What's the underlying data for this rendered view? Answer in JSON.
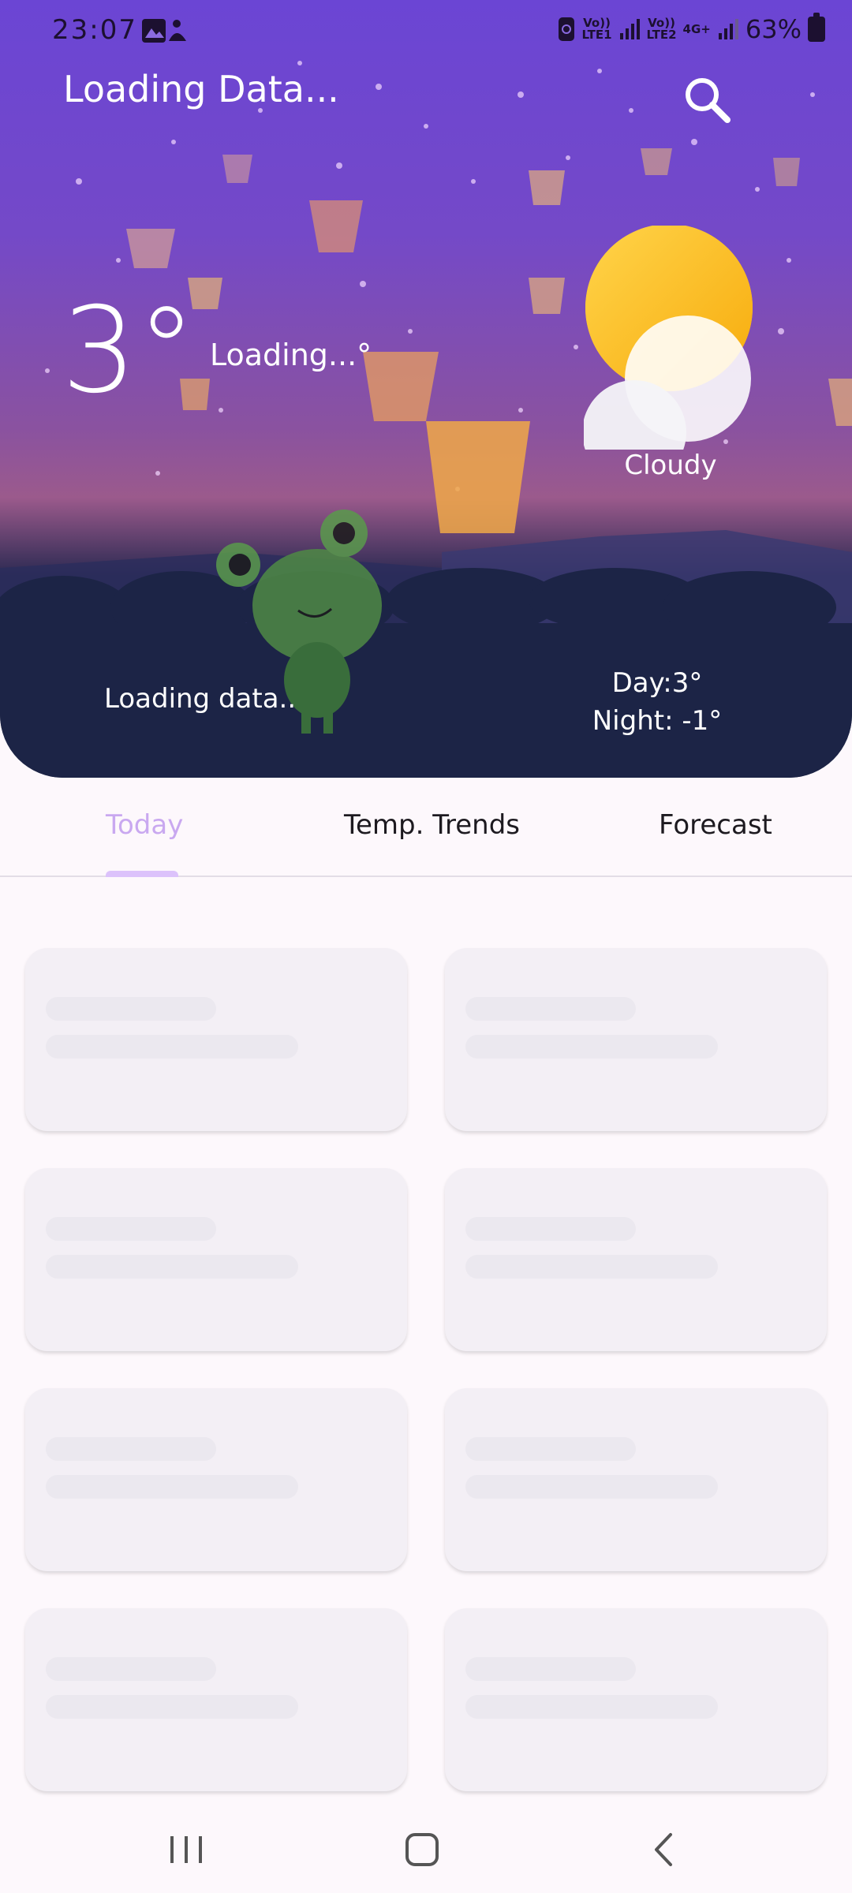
{
  "status_bar": {
    "time": "23:07",
    "left_icons": [
      "gallery-icon",
      "app-notification-icon"
    ],
    "sim1": {
      "top": "Vo))",
      "bottom": "LTE1"
    },
    "sim2": {
      "top": "Vo))",
      "bottom": "LTE2"
    },
    "network": "4G+",
    "battery": "63%"
  },
  "header": {
    "title": "Loading Data...",
    "search_icon": "search-icon"
  },
  "current": {
    "temperature": "3°",
    "feels_like": "Loading...°",
    "condition": "Cloudy",
    "condition_icon": "sun-behind-cloud-icon",
    "summary": "Loading data..",
    "day": "Day:3°",
    "night": "Night: -1°"
  },
  "tabs": [
    {
      "label": "Today",
      "active": true
    },
    {
      "label": "Temp. Trends",
      "active": false
    },
    {
      "label": "Forecast",
      "active": false
    }
  ],
  "skeleton_cards": 8,
  "nav": {
    "recents_icon": "recents-icon",
    "home_icon": "home-icon",
    "back_icon": "back-icon"
  },
  "colors": {
    "accent": "#c9a8f0",
    "sky_top": "#6b45d4",
    "sky_mid": "#9b5a8c",
    "ground": "#15203c",
    "skeleton_card": "#f3eff5",
    "skeleton_bar": "#ebe8ef"
  }
}
